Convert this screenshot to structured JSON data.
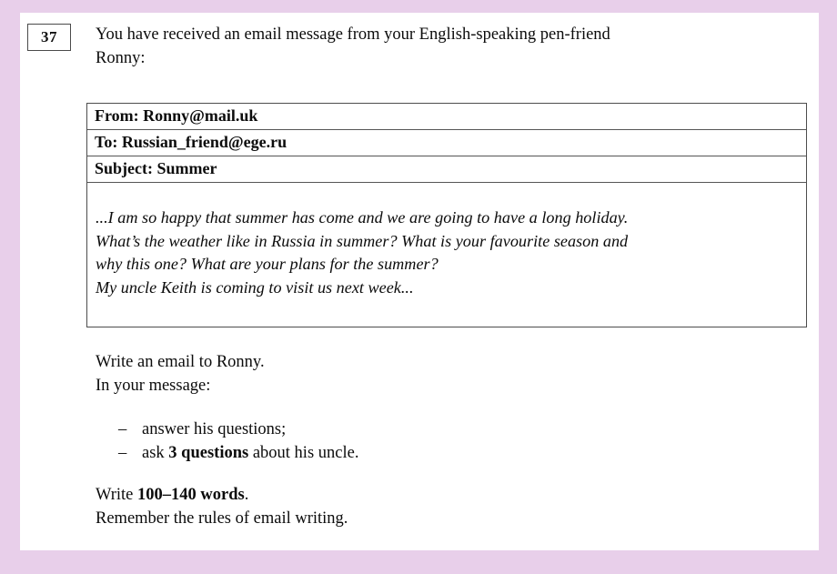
{
  "page": {
    "background_color": "#e8cfea",
    "paper_color": "#ffffff"
  },
  "task": {
    "number": "37",
    "intro_line1": "You have received an email message from your English-speaking pen-friend",
    "intro_line2": "Ronny:"
  },
  "email": {
    "from": "From: Ronny@mail.uk",
    "to": "To: Russian_friend@ege.ru",
    "subject": "Subject: Summer",
    "body_line1": "...I am so happy that summer has come and we are going to have a long holiday.",
    "body_line2": "What’s the weather like in Russia in summer? What is your favourite season and",
    "body_line3": "why this one? What are your plans for the summer?",
    "body_line4": "My uncle Keith is coming to visit us next week..."
  },
  "instructions": {
    "line1": "Write an email to Ronny.",
    "line2": "In your message:",
    "bullets": [
      {
        "dash": "–",
        "text_before": "answer his questions;",
        "bold": "",
        "text_after": ""
      },
      {
        "dash": "–",
        "text_before": "ask ",
        "bold": "3 questions",
        "text_after": " about his uncle."
      }
    ],
    "closing_before": "Write ",
    "closing_bold": "100–140 words",
    "closing_after": ".",
    "final_line": "Remember the rules of email writing."
  }
}
